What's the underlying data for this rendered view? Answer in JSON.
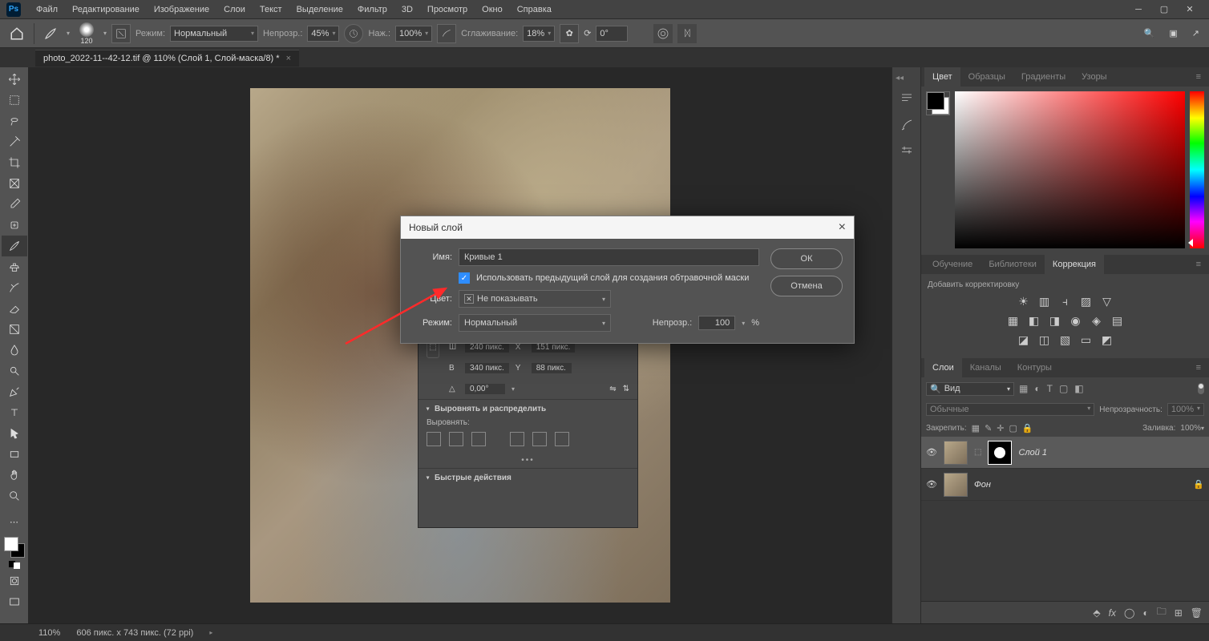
{
  "menu": {
    "items": [
      "Файл",
      "Редактирование",
      "Изображение",
      "Слои",
      "Текст",
      "Выделение",
      "Фильтр",
      "3D",
      "Просмотр",
      "Окно",
      "Справка"
    ]
  },
  "options": {
    "brush_size": "120",
    "mode_label": "Режим:",
    "mode_value": "Нормальный",
    "opacity_label": "Непрозр.:",
    "opacity_value": "45%",
    "flow_label": "Наж.:",
    "flow_value": "100%",
    "smoothing_label": "Сглаживание:",
    "smoothing_value": "18%",
    "angle_symbol": "⟳",
    "angle_value": "0°"
  },
  "doc": {
    "tab": "photo_2022-11--42-12.tif @ 110% (Слой 1, Слой-маска/8) *"
  },
  "props": {
    "w_lbl": "Ш",
    "w_val": "240 пикс.",
    "x_lbl": "X",
    "x_val": "151 пикс.",
    "h_lbl": "В",
    "h_val": "340 пикс.",
    "y_lbl": "Y",
    "y_val": "88 пикс.",
    "angle_lbl": "△",
    "angle_val": "0,00°",
    "sec1": "Выровнять и распределить",
    "sub1": "Выровнять:",
    "sec2": "Быстрые действия"
  },
  "dialog": {
    "title": "Новый слой",
    "name_label": "Имя:",
    "name_value": "Кривые 1",
    "clip_label": "Использовать предыдущий слой для создания обтравочной маски",
    "color_label": "Цвет:",
    "color_value": "Не показывать",
    "mode_label": "Режим:",
    "mode_value": "Нормальный",
    "opacity_label": "Непрозр.:",
    "opacity_value": "100",
    "opacity_pct": "%",
    "ok": "ОК",
    "cancel": "Отмена"
  },
  "panels": {
    "color_tabs": [
      "Цвет",
      "Образцы",
      "Градиенты",
      "Узоры"
    ],
    "learn_tabs": [
      "Обучение",
      "Библиотеки",
      "Коррекция"
    ],
    "adjust_label": "Добавить корректировку",
    "layers_tabs": [
      "Слои",
      "Каналы",
      "Контуры"
    ],
    "layer_filter_label": "Вид",
    "blend_mode": "Обычные",
    "opacity_label": "Непрозрачность:",
    "opacity_value": "100%",
    "lock_label": "Закрепить:",
    "fill_label": "Заливка:",
    "fill_value": "100%",
    "layers": [
      {
        "name": "Слой 1"
      },
      {
        "name": "Фон"
      }
    ]
  },
  "status": {
    "zoom": "110%",
    "docinfo": "606 пикс. x 743 пикс. (72 ppi)"
  }
}
